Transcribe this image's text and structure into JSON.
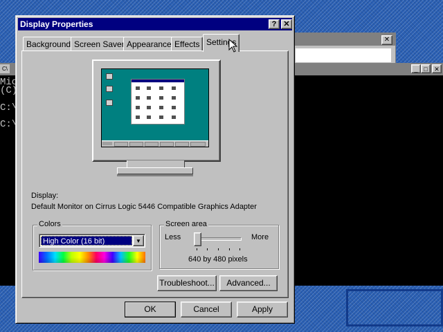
{
  "background": {
    "console": {
      "icon": "C\\",
      "lines": [
        "Mic",
        "(C)",
        "",
        "C:\\",
        "",
        "C:\\"
      ],
      "button_min": "_",
      "button_max": "□",
      "button_close": "✕"
    },
    "window_close": "✕"
  },
  "dialog": {
    "title": "Display Properties",
    "help_button": "?",
    "close_button": "✕",
    "tabs": [
      {
        "label": "Background"
      },
      {
        "label": "Screen Saver"
      },
      {
        "label": "Appearance"
      },
      {
        "label": "Effects"
      },
      {
        "label": "Settings",
        "active": true
      }
    ],
    "display_label": "Display:",
    "display_value": "Default Monitor on Cirrus Logic 5446 Compatible Graphics Adapter",
    "colors": {
      "title": "Colors",
      "selected": "High Color (16 bit)"
    },
    "screen_area": {
      "title": "Screen area",
      "less": "Less",
      "more": "More",
      "value": "640 by 480 pixels",
      "slider_position": 0
    },
    "buttons": {
      "troubleshoot": "Troubleshoot...",
      "advanced": "Advanced...",
      "ok": "OK",
      "cancel": "Cancel",
      "apply": "Apply"
    }
  }
}
